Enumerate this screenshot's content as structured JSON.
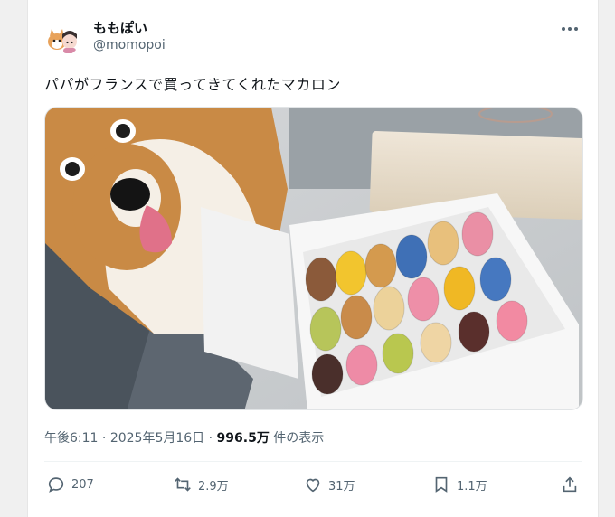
{
  "user": {
    "display_name": "ももぽい",
    "handle": "@momopoi"
  },
  "tweet": {
    "text": "パパがフランスで買ってきてくれたマカロン",
    "time": "午後6:11",
    "date": "2025年5月16日",
    "views": "996.5万",
    "views_label": "件の表示"
  },
  "actions": {
    "replies": "207",
    "retweets": "2.9万",
    "likes": "31万",
    "bookmarks": "1.1万"
  },
  "icons": [
    "more-icon",
    "reply-icon",
    "retweet-icon",
    "like-icon",
    "bookmark-icon",
    "share-icon"
  ],
  "colors": {
    "text": "#0f1419",
    "secondary": "#536471",
    "divider": "#eff3f4"
  }
}
